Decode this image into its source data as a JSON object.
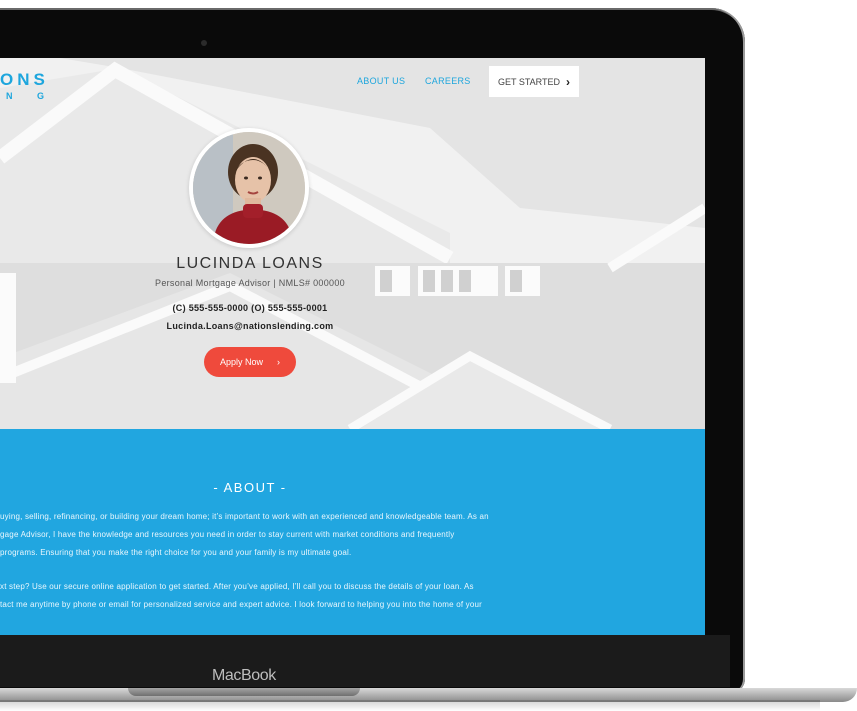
{
  "device": {
    "label": "MacBook"
  },
  "header": {
    "logo_top": "ONS",
    "logo_sub": "N G",
    "nav": {
      "about": "ABOUT US",
      "careers": "CAREERS",
      "get_started": "GET STARTED"
    }
  },
  "profile": {
    "name": "LUCINDA LOANS",
    "title": "Personal Mortgage Advisor | NMLS# 000000",
    "phones": "(C) 555-555-0000   (O) 555-555-0001",
    "email": "Lucinda.Loans@nationslending.com",
    "apply_label": "Apply Now"
  },
  "about": {
    "heading": "- ABOUT -",
    "lines": [
      "uying, selling, refinancing, or building your dream home; it’s important to work with an experienced and knowledgeable team. As an",
      "gage Advisor, I have the knowledge and resources you need in order to stay current with market conditions and frequently",
      "programs. Ensuring that you make the right choice for you and your family is my ultimate goal.",
      "xt step? Use our secure online application to get started. After you’ve applied, I’ll call you to discuss the details of your loan. As",
      "tact me anytime by phone or email for personalized service and expert advice. I look forward to helping you into the home of your"
    ]
  },
  "colors": {
    "brand_blue": "#21a6e0",
    "apply_red": "#ef4a3c"
  },
  "icons": {
    "nav_arrow": "chevron-right-icon",
    "apply_arrow": "chevron-right-icon"
  }
}
